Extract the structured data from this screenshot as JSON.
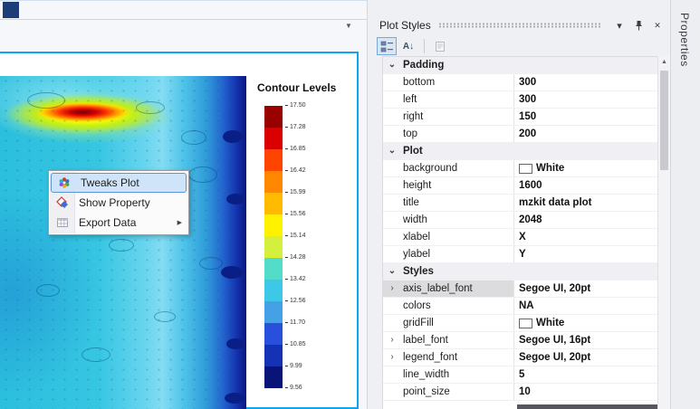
{
  "window": {
    "app_icon_color": "#1d3c78",
    "properties_tab_label": "Properties"
  },
  "icons": {
    "combo_dropdown": "▼",
    "window_position": "▾",
    "close": "✕",
    "submenu_arrow": "▶",
    "category_expanded": "⌄",
    "expandable": "›",
    "scroll_up": "▲",
    "sort_glyph": "A↓"
  },
  "legend": {
    "title": "Contour Levels",
    "ticks": [
      "17.50",
      "17.28",
      "16.85",
      "16.42",
      "15.99",
      "15.56",
      "15.14",
      "14.28",
      "13.42",
      "12.56",
      "11.70",
      "10.85",
      "9.99",
      "9.56"
    ],
    "colors": [
      "#990000",
      "#db0000",
      "#ff4400",
      "#ff8800",
      "#ffbb00",
      "#fff200",
      "#d4f03c",
      "#53dcc8",
      "#3cc8e6",
      "#46a0e6",
      "#2850dc",
      "#1632b4",
      "#0a1478"
    ]
  },
  "context_menu": {
    "items": [
      {
        "label": "Tweaks Plot"
      },
      {
        "label": "Show Property"
      },
      {
        "label": "Export Data"
      }
    ]
  },
  "panel": {
    "title": "Plot Styles",
    "grid_rows": [
      {
        "type": "category",
        "label": "Padding"
      },
      {
        "type": "prop",
        "name": "bottom",
        "value": "300"
      },
      {
        "type": "prop",
        "name": "left",
        "value": "300"
      },
      {
        "type": "prop",
        "name": "right",
        "value": "150"
      },
      {
        "type": "prop",
        "name": "top",
        "value": "200"
      },
      {
        "type": "category",
        "label": "Plot"
      },
      {
        "type": "prop",
        "name": "background",
        "value": "White",
        "swatch": "#ffffff"
      },
      {
        "type": "prop",
        "name": "height",
        "value": "1600"
      },
      {
        "type": "prop",
        "name": "title",
        "value": "mzkit data plot"
      },
      {
        "type": "prop",
        "name": "width",
        "value": "2048"
      },
      {
        "type": "prop",
        "name": "xlabel",
        "value": "X"
      },
      {
        "type": "prop",
        "name": "ylabel",
        "value": "Y"
      },
      {
        "type": "category",
        "label": "Styles"
      },
      {
        "type": "prop",
        "name": "axis_label_font",
        "value": "Segoe UI, 20pt",
        "expandable": true,
        "selected": true
      },
      {
        "type": "prop",
        "name": "colors",
        "value": "NA"
      },
      {
        "type": "prop",
        "name": "gridFill",
        "value": "White",
        "swatch": "#ffffff"
      },
      {
        "type": "prop",
        "name": "label_font",
        "value": "Segoe UI, 16pt",
        "expandable": true
      },
      {
        "type": "prop",
        "name": "legend_font",
        "value": "Segoe UI, 20pt",
        "expandable": true
      },
      {
        "type": "prop",
        "name": "line_width",
        "value": "5"
      },
      {
        "type": "prop",
        "name": "point_size",
        "value": "10"
      }
    ]
  }
}
